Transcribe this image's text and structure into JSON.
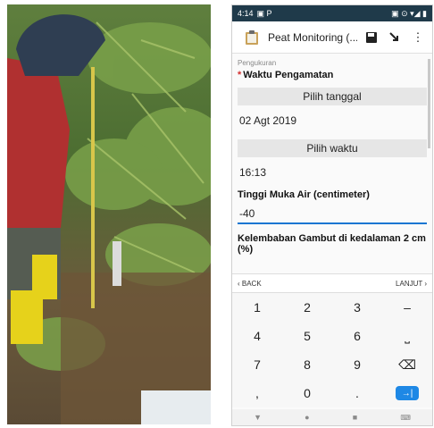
{
  "photo": {
    "description_icon": "field-photo"
  },
  "statusbar": {
    "time": "4:14",
    "left_icons": "▣ P",
    "right_icons": "▣ ⊙ ▾◢ ▮"
  },
  "appbar": {
    "title": "Peat Monitoring (...",
    "save_icon": "save-icon",
    "menu_icon": "more-vert-icon"
  },
  "form": {
    "section": "Pengukuran",
    "q1_label": "Waktu Pengamatan",
    "date_button": "Pilih tanggal",
    "date_value": "02 Agt 2019",
    "time_button": "Pilih waktu",
    "time_value": "16:13",
    "q2_label": "Tinggi Muka Air (centimeter)",
    "q2_value": "-40",
    "q3_label": "Kelembaban Gambut di kedalaman 2 cm (%)"
  },
  "nav": {
    "back": "‹  BACK",
    "next": "LANJUT  ›"
  },
  "keypad": {
    "k1": "1",
    "k2": "2",
    "k3": "3",
    "kminus": "–",
    "k4": "4",
    "k5": "5",
    "k6": "6",
    "kspace": "⎵",
    "k7": "7",
    "k8": "8",
    "k9": "9",
    "kdel": "⌫",
    "kcomma": ",",
    "k0": "0",
    "kdot": ".",
    "kenter": "→|"
  },
  "sysnav": {
    "back": "▼",
    "home": "●",
    "recents": "■",
    "kbd": "⌨"
  },
  "colors": {
    "accent": "#1976d2",
    "statusbar": "#1f3a4a",
    "required": "#d32f2f",
    "enter": "#1e88e5"
  }
}
